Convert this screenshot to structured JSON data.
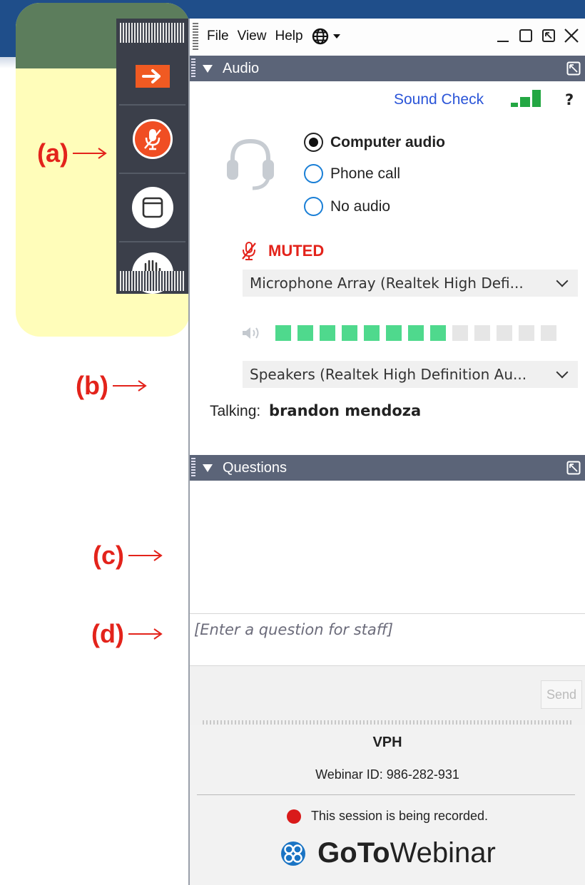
{
  "menubar": {
    "items": [
      "File",
      "View",
      "Help"
    ]
  },
  "audio": {
    "title": "Audio",
    "sound_check": "Sound Check",
    "help": "?",
    "options": [
      "Computer audio",
      "Phone call",
      "No audio"
    ],
    "selected_option": "Computer audio",
    "muted_label": "MUTED",
    "microphone": "Microphone Array (Realtek High Defi...",
    "speakers": "Speakers (Realtek High Definition Au...",
    "volume_level": 0.62,
    "talking_label": "Talking:",
    "talking_name": "brandon mendoza"
  },
  "questions": {
    "title": "Questions",
    "placeholder": "[Enter a question for staff]",
    "send_label": "Send"
  },
  "footer": {
    "organizer": "VPH",
    "webinar_id": "Webinar ID: 986-282-931",
    "recording_notice": "This session is being recorded.",
    "brand_bold": "GoTo",
    "brand_light": "Webinar"
  },
  "annotations": {
    "a": "(a)",
    "b": "(b)",
    "c": "(c)",
    "d": "(d)"
  },
  "colors": {
    "accent_orange": "#f05a22",
    "muted_red": "#e3231b",
    "link_blue": "#2b55d8",
    "level_green": "#4fd98d",
    "signal_green": "#23a743",
    "header_gray": "#5b6478"
  }
}
